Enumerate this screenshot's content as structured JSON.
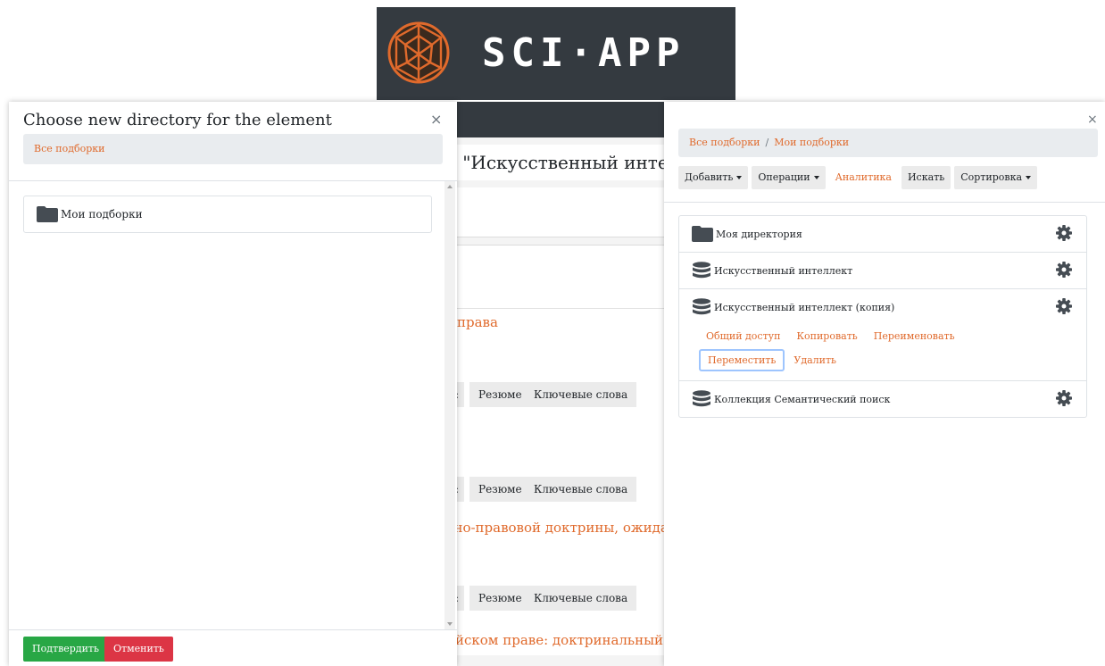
{
  "logo": {
    "text": "SCI·APP",
    "globe_color": "#e06a2c"
  },
  "background_page": {
    "title": "е \"Искусственный интелл",
    "links": [
      "права",
      "вно-правовой доктрины, ожидающ",
      "ийском праве: доктринальный ана"
    ],
    "buttons": {
      "truncated": ":",
      "resume": "Резюме",
      "keywords": "Ключевые слова"
    }
  },
  "left_modal": {
    "title": "Choose new directory for the element",
    "close": "×",
    "breadcrumb": "Все подборки",
    "items": [
      {
        "label": "Мои подборки",
        "icon": "folder-icon"
      }
    ],
    "confirm": "Подтвердить",
    "cancel": "Отменить"
  },
  "right_panel": {
    "close": "×",
    "breadcrumb": {
      "root": "Все подборки",
      "separator": "/",
      "current": "Мои подборки"
    },
    "toolbar": {
      "add": "Добавить",
      "operations": "Операции",
      "analytics": "Аналитика",
      "search": "Искать",
      "sort": "Сортировка"
    },
    "items": [
      {
        "label": "Моя директория",
        "icon": "folder-icon"
      },
      {
        "label": "Искусственный интеллект",
        "icon": "database-icon"
      },
      {
        "label": "Искусственный интеллект (копия)",
        "icon": "database-icon",
        "actions": [
          "Общий доступ",
          "Копировать",
          "Переименовать",
          "Переместить",
          "Удалить"
        ]
      },
      {
        "label": "Коллекция Семантический поиск",
        "icon": "database-icon"
      }
    ]
  },
  "colors": {
    "accent": "#e06a2c",
    "confirm": "#28a745",
    "cancel": "#dc3545",
    "header": "#343a40",
    "focus_ring": "#9ec5fe"
  }
}
